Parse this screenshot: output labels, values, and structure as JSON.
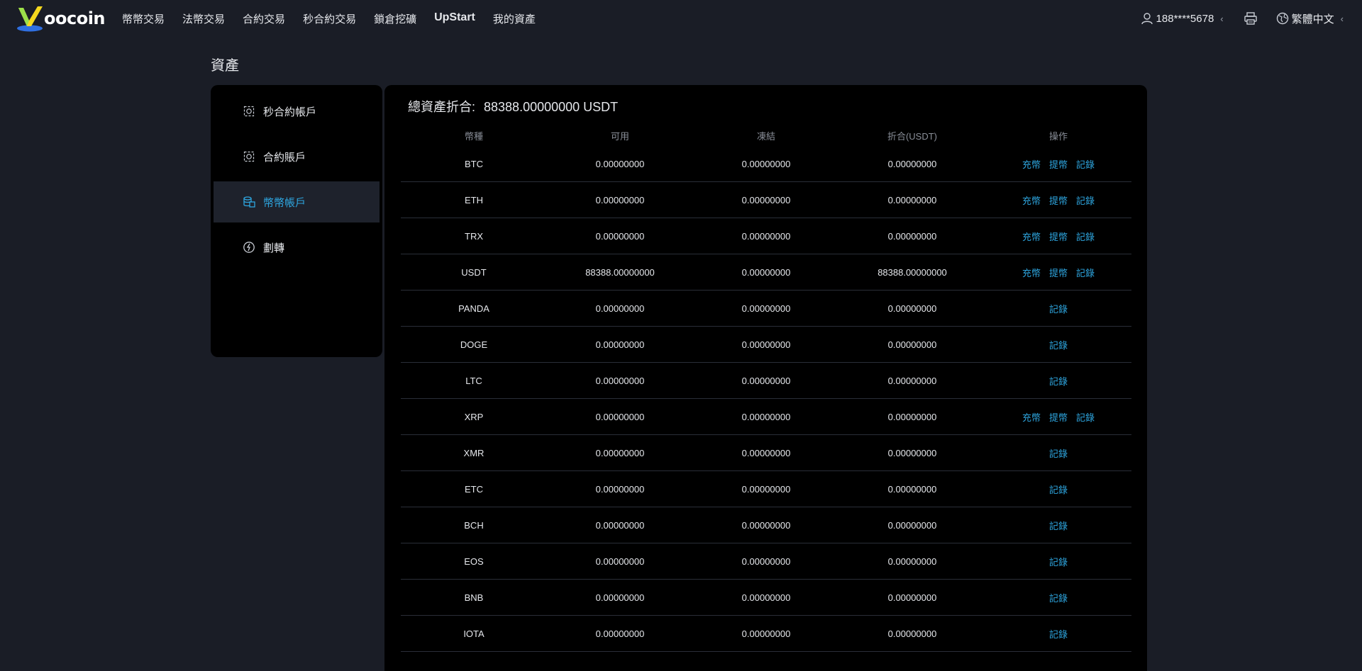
{
  "header": {
    "logo_text": "oocoin",
    "nav": [
      "幣幣交易",
      "法幣交易",
      "合約交易",
      "秒合約交易",
      "鎖倉挖礦",
      "UpStart",
      "我的資產"
    ],
    "user": "188****5678",
    "language": "繁體中文"
  },
  "page_title": "資產",
  "sidebar": {
    "items": [
      {
        "label": "秒合約帳戶",
        "icon": "contract-icon"
      },
      {
        "label": "合約賬戶",
        "icon": "contract-icon"
      },
      {
        "label": "幣幣帳戶",
        "icon": "coins-icon"
      },
      {
        "label": "劃轉",
        "icon": "transfer-icon"
      }
    ],
    "active_index": 2
  },
  "summary": {
    "label": "總資產折合:",
    "value": "88388.00000000 USDT"
  },
  "table": {
    "columns": [
      "幣種",
      "可用",
      "凍結",
      "折合(USDT)",
      "操作"
    ],
    "action_labels": {
      "deposit": "充幣",
      "withdraw": "提幣",
      "record": "記錄"
    },
    "rows": [
      {
        "coin": "BTC",
        "available": "0.00000000",
        "frozen": "0.00000000",
        "usdt": "0.00000000",
        "full_actions": true
      },
      {
        "coin": "ETH",
        "available": "0.00000000",
        "frozen": "0.00000000",
        "usdt": "0.00000000",
        "full_actions": true
      },
      {
        "coin": "TRX",
        "available": "0.00000000",
        "frozen": "0.00000000",
        "usdt": "0.00000000",
        "full_actions": true
      },
      {
        "coin": "USDT",
        "available": "88388.00000000",
        "frozen": "0.00000000",
        "usdt": "88388.00000000",
        "full_actions": true
      },
      {
        "coin": "PANDA",
        "available": "0.00000000",
        "frozen": "0.00000000",
        "usdt": "0.00000000",
        "full_actions": false
      },
      {
        "coin": "DOGE",
        "available": "0.00000000",
        "frozen": "0.00000000",
        "usdt": "0.00000000",
        "full_actions": false
      },
      {
        "coin": "LTC",
        "available": "0.00000000",
        "frozen": "0.00000000",
        "usdt": "0.00000000",
        "full_actions": false
      },
      {
        "coin": "XRP",
        "available": "0.00000000",
        "frozen": "0.00000000",
        "usdt": "0.00000000",
        "full_actions": true
      },
      {
        "coin": "XMR",
        "available": "0.00000000",
        "frozen": "0.00000000",
        "usdt": "0.00000000",
        "full_actions": false
      },
      {
        "coin": "ETC",
        "available": "0.00000000",
        "frozen": "0.00000000",
        "usdt": "0.00000000",
        "full_actions": false
      },
      {
        "coin": "BCH",
        "available": "0.00000000",
        "frozen": "0.00000000",
        "usdt": "0.00000000",
        "full_actions": false
      },
      {
        "coin": "EOS",
        "available": "0.00000000",
        "frozen": "0.00000000",
        "usdt": "0.00000000",
        "full_actions": false
      },
      {
        "coin": "BNB",
        "available": "0.00000000",
        "frozen": "0.00000000",
        "usdt": "0.00000000",
        "full_actions": false
      },
      {
        "coin": "IOTA",
        "available": "0.00000000",
        "frozen": "0.00000000",
        "usdt": "0.00000000",
        "full_actions": false
      }
    ]
  },
  "colors": {
    "background": "#1a1d26",
    "panel": "#000000",
    "accent": "#2ea6e0",
    "logo_yellow": "#f5d81e",
    "logo_blue": "#2f6fe0"
  }
}
